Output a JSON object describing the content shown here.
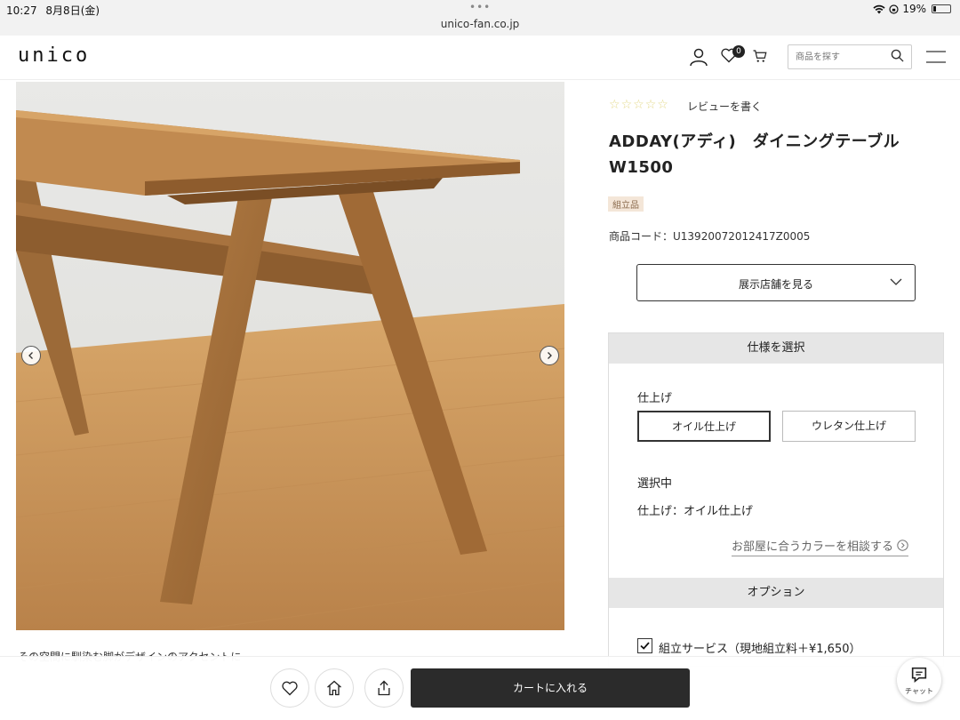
{
  "status_bar": {
    "time": "10:27",
    "date": "8月8日(金)",
    "url": "unico-fan.co.jp",
    "battery": "19%",
    "battery_level": 0.19
  },
  "header": {
    "logo": "unico",
    "wishlist_count": "0",
    "search_placeholder": "商品を探す"
  },
  "product": {
    "review_label": "レビューを書く",
    "rating_stars": 5,
    "title": "ADDAY(アディ)　ダイニングテーブル W1500",
    "tag": "組立品",
    "code": "商品コード：U13920072012417Z0005",
    "store_button": "展示店舗を見る",
    "caption": "その空間に馴染む脚がデザインのアクセントに"
  },
  "spec": {
    "header": "仕様を選択",
    "finish_label": "仕上げ",
    "options": [
      "オイル仕上げ",
      "ウレタン仕上げ"
    ],
    "selected_heading": "選択中",
    "selected_value": "仕上げ：オイル仕上げ",
    "consult_link": "お部屋に合うカラーを相談する"
  },
  "option": {
    "header": "オプション",
    "assembly_label": "組立サービス（現地組立料＋¥1,650）",
    "assembly_checked": true
  },
  "bottom_bar": {
    "cart_button": "カートに入れる",
    "chat_label": "チャット"
  },
  "colors": {
    "accent_dark": "#2b2b2b",
    "tag_bg": "#f4e6d8",
    "panel_head": "#e6e6e6"
  }
}
